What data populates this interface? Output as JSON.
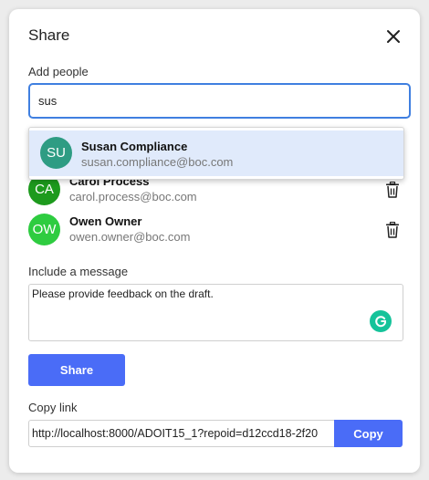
{
  "dialog": {
    "title": "Share",
    "close_icon": "close-icon"
  },
  "add_people": {
    "label": "Add people",
    "search_value": "sus"
  },
  "suggestion": {
    "initials": "SU",
    "name": "Susan Compliance",
    "email": "susan.compliance@boc.com",
    "avatar_color": "#2e9c83",
    "highlight_color": "#e0eafb"
  },
  "people": [
    {
      "initials": "CA",
      "name": "Carol Process",
      "email": "carol.process@boc.com",
      "avatar_color": "#1d9a1d",
      "action_icon": "trash-icon"
    },
    {
      "initials": "OW",
      "name": "Owen Owner",
      "email": "owen.owner@boc.com",
      "avatar_color": "#2ecc40",
      "action_icon": "trash-icon"
    }
  ],
  "message": {
    "label": "Include a message",
    "value": "Please provide feedback on the draft.",
    "grammarly_icon": "grammarly-icon"
  },
  "share_button": {
    "label": "Share",
    "color": "#4a6cf7"
  },
  "copy_link": {
    "label": "Copy link",
    "value": "http://localhost:8000/ADOIT15_1?repoid=d12ccd18-2f20",
    "button_label": "Copy"
  }
}
